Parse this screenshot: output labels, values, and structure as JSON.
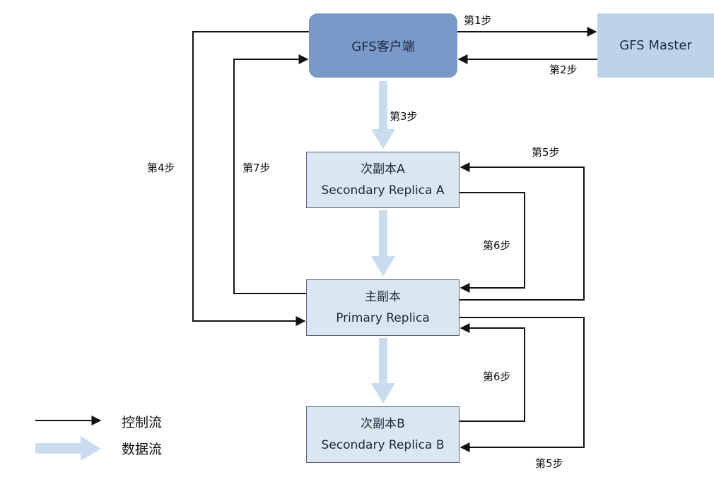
{
  "nodes": {
    "client": "GFS客户端",
    "master": "GFS Master",
    "secondary_a": {
      "name": "次副本A",
      "subtitle": "Secondary Replica A"
    },
    "primary": {
      "name": "主副本",
      "subtitle": "Primary Replica"
    },
    "secondary_b": {
      "name": "次副本B",
      "subtitle": "Secondary Replica B"
    }
  },
  "steps": {
    "s1": "第1步",
    "s2": "第2步",
    "s3": "第3步",
    "s4": "第4步",
    "s5_top": "第5步",
    "s5_bottom": "第5步",
    "s6_top": "第6步",
    "s6_bottom": "第6步",
    "s7": "第7步"
  },
  "legend": {
    "control_flow": "控制流",
    "data_flow": "数据流"
  },
  "colors": {
    "control_arrow": "#111111",
    "data_arrow": "#c9dcee",
    "client_fill": "#7a98c8",
    "master_fill": "#bcd3ea",
    "replica_fill": "#dbe6f3"
  }
}
